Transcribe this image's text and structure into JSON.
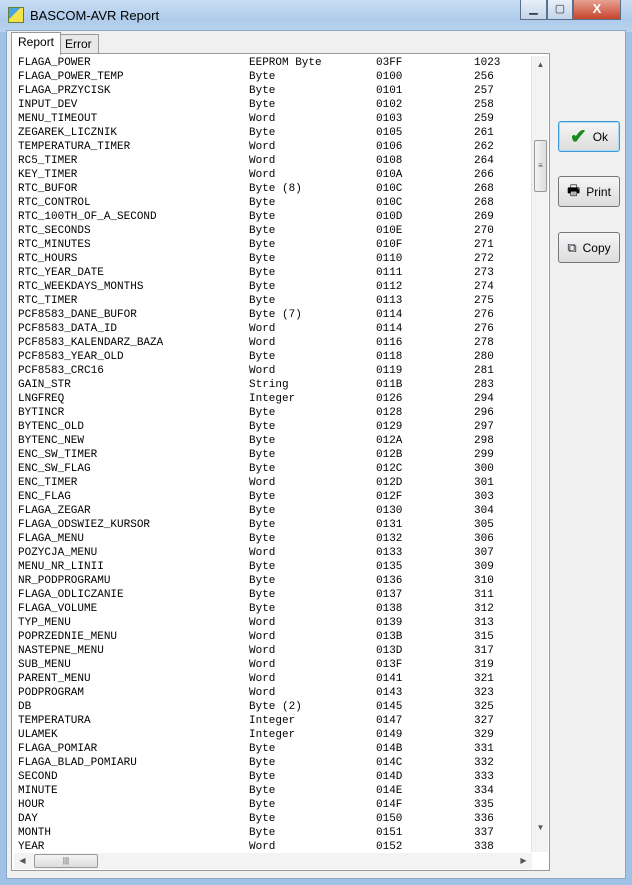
{
  "window": {
    "title": "BASCOM-AVR Report",
    "icon_text": "AVR",
    "minimize": "▁",
    "maximize": "▢",
    "close": "X"
  },
  "tabs": [
    {
      "label": "Report"
    },
    {
      "label": "Error"
    }
  ],
  "rows": [
    [
      "FLAGA_POWER",
      "EEPROM Byte",
      "03FF",
      "1023"
    ],
    [
      "FLAGA_POWER_TEMP",
      "Byte",
      "0100",
      "256"
    ],
    [
      "FLAGA_PRZYCISK",
      "Byte",
      "0101",
      "257"
    ],
    [
      "INPUT_DEV",
      "Byte",
      "0102",
      "258"
    ],
    [
      "MENU_TIMEOUT",
      "Word",
      "0103",
      "259"
    ],
    [
      "ZEGAREK_LICZNIK",
      "Byte",
      "0105",
      "261"
    ],
    [
      "TEMPERATURA_TIMER",
      "Word",
      "0106",
      "262"
    ],
    [
      "RC5_TIMER",
      "Word",
      "0108",
      "264"
    ],
    [
      "KEY_TIMER",
      "Word",
      "010A",
      "266"
    ],
    [
      "RTC_BUFOR",
      "Byte (8)",
      "010C",
      "268"
    ],
    [
      "RTC_CONTROL",
      "Byte",
      "010C",
      "268"
    ],
    [
      "RTC_100TH_OF_A_SECOND",
      "Byte",
      "010D",
      "269"
    ],
    [
      "RTC_SECONDS",
      "Byte",
      "010E",
      "270"
    ],
    [
      "RTC_MINUTES",
      "Byte",
      "010F",
      "271"
    ],
    [
      "RTC_HOURS",
      "Byte",
      "0110",
      "272"
    ],
    [
      "RTC_YEAR_DATE",
      "Byte",
      "0111",
      "273"
    ],
    [
      "RTC_WEEKDAYS_MONTHS",
      "Byte",
      "0112",
      "274"
    ],
    [
      "RTC_TIMER",
      "Byte",
      "0113",
      "275"
    ],
    [
      "PCF8583_DANE_BUFOR",
      "Byte (7)",
      "0114",
      "276"
    ],
    [
      "PCF8583_DATA_ID",
      "Word",
      "0114",
      "276"
    ],
    [
      "PCF8583_KALENDARZ_BAZA",
      "Word",
      "0116",
      "278"
    ],
    [
      "PCF8583_YEAR_OLD",
      "Byte",
      "0118",
      "280"
    ],
    [
      "PCF8583_CRC16",
      "Word",
      "0119",
      "281"
    ],
    [
      "GAIN_STR",
      "String",
      "011B",
      "283"
    ],
    [
      "LNGFREQ",
      "Integer",
      "0126",
      "294"
    ],
    [
      "BYTINCR",
      "Byte",
      "0128",
      "296"
    ],
    [
      "BYTENC_OLD",
      "Byte",
      "0129",
      "297"
    ],
    [
      "BYTENC_NEW",
      "Byte",
      "012A",
      "298"
    ],
    [
      "ENC_SW_TIMER",
      "Byte",
      "012B",
      "299"
    ],
    [
      "ENC_SW_FLAG",
      "Byte",
      "012C",
      "300"
    ],
    [
      "ENC_TIMER",
      "Word",
      "012D",
      "301"
    ],
    [
      "ENC_FLAG",
      "Byte",
      "012F",
      "303"
    ],
    [
      "FLAGA_ZEGAR",
      "Byte",
      "0130",
      "304"
    ],
    [
      "FLAGA_ODSWIEZ_KURSOR",
      "Byte",
      "0131",
      "305"
    ],
    [
      "FLAGA_MENU",
      "Byte",
      "0132",
      "306"
    ],
    [
      "POZYCJA_MENU",
      "Word",
      "0133",
      "307"
    ],
    [
      "MENU_NR_LINII",
      "Byte",
      "0135",
      "309"
    ],
    [
      "NR_PODPROGRAMU",
      "Byte",
      "0136",
      "310"
    ],
    [
      "FLAGA_ODLICZANIE",
      "Byte",
      "0137",
      "311"
    ],
    [
      "FLAGA_VOLUME",
      "Byte",
      "0138",
      "312"
    ],
    [
      "TYP_MENU",
      "Word",
      "0139",
      "313"
    ],
    [
      "POPRZEDNIE_MENU",
      "Word",
      "013B",
      "315"
    ],
    [
      "NASTEPNE_MENU",
      "Word",
      "013D",
      "317"
    ],
    [
      "SUB_MENU",
      "Word",
      "013F",
      "319"
    ],
    [
      "PARENT_MENU",
      "Word",
      "0141",
      "321"
    ],
    [
      "PODPROGRAM",
      "Word",
      "0143",
      "323"
    ],
    [
      "DB",
      "Byte (2)",
      "0145",
      "325"
    ],
    [
      "TEMPERATURA",
      "Integer",
      "0147",
      "327"
    ],
    [
      "ULAMEK",
      "Integer",
      "0149",
      "329"
    ],
    [
      "FLAGA_POMIAR",
      "Byte",
      "014B",
      "331"
    ],
    [
      "FLAGA_BLAD_POMIARU",
      "Byte",
      "014C",
      "332"
    ],
    [
      "SECOND",
      "Byte",
      "014D",
      "333"
    ],
    [
      "MINUTE",
      "Byte",
      "014E",
      "334"
    ],
    [
      "HOUR",
      "Byte",
      "014F",
      "335"
    ],
    [
      "DAY",
      "Byte",
      "0150",
      "336"
    ],
    [
      "MONTH",
      "Byte",
      "0151",
      "337"
    ],
    [
      "YEAR",
      "Word",
      "0152",
      "338"
    ]
  ],
  "buttons": {
    "ok": "Ok",
    "print": "Print",
    "copy": "Copy"
  },
  "colors": {
    "check": "#1a8a1a",
    "title_bar": "#b9d3ee"
  }
}
